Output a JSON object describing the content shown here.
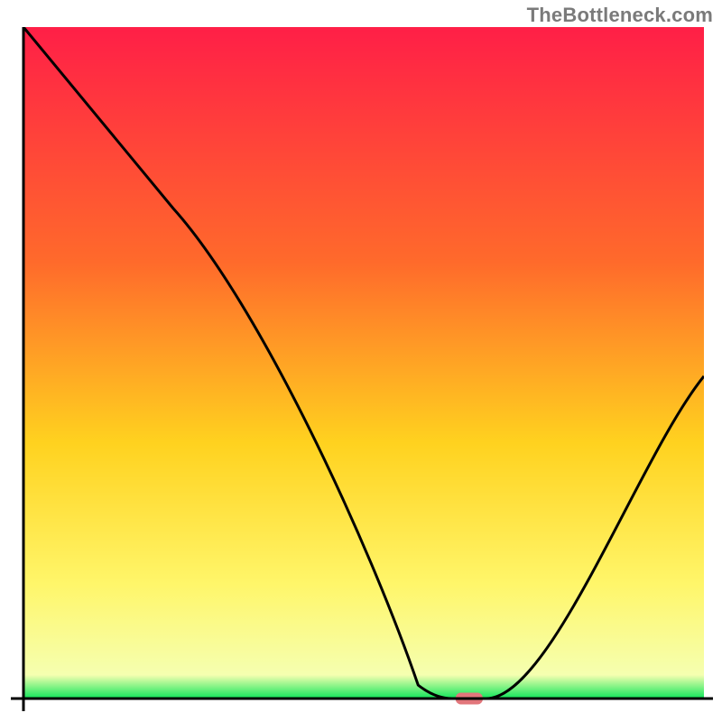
{
  "watermark": "TheBottleneck.com",
  "colors": {
    "gradient_top": "#ff1f47",
    "gradient_mid1": "#ff6a2b",
    "gradient_mid2": "#ffd21f",
    "gradient_mid3": "#fff66a",
    "gradient_green": "#0fe65a",
    "axis": "#000000",
    "curve": "#000000",
    "marker": "#e2767b"
  },
  "chart_data": {
    "type": "line",
    "title": "",
    "xlabel": "",
    "ylabel": "",
    "xlim": [
      0,
      100
    ],
    "ylim": [
      0,
      100
    ],
    "grid": false,
    "x": [
      0,
      22,
      58,
      63,
      68,
      100
    ],
    "values": [
      100,
      73,
      2,
      0,
      0,
      48
    ],
    "marker": {
      "x": 65.5,
      "y": 0,
      "w": 4,
      "h": 2
    },
    "notes": "Percent-of-range coordinates. y=0 at the bottom axis, y=100 at the top. Curve kinks at x≈22, hits bottom plateau ~58→68, then rises to ~48 at x=100."
  }
}
